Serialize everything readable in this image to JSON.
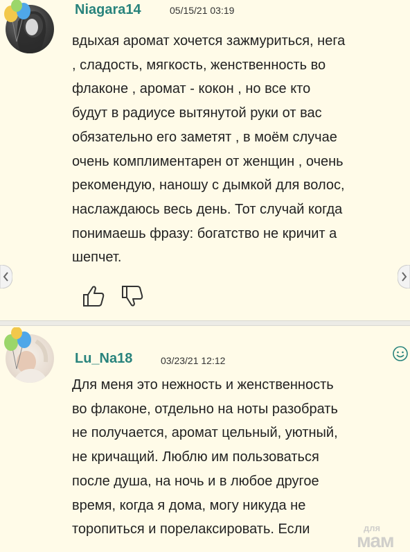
{
  "comments": [
    {
      "username": "Niagara14",
      "date": "05/15/21 03:19",
      "text": "вдыхая аромат хочется зажмуриться, нега\n, сладость, мягкость, женственность во\nфлаконе , аромат - кокон , но все кто\nбудут в радиусе вытянутой руки от вас\nобязательно его заметят , в моём случае\nочень комплиментарен от женщин , очень\nрекомендую, наношу с дымкой для волос,\nнаслаждаюсь весь день. Тот случай когда\nпонимаешь фразу: богатство не кричит а\nшепчет."
    },
    {
      "username": "Lu_Na18",
      "date": "03/23/21 12:12",
      "text": "Для меня это нежность и женственность\nво флаконе, отдельно на ноты разобрать\nне получается, аромат цельный, уютный,\nне кричащий. Люблю им пользоваться\nпосле душа, на ночь и в любое другое\nвремя, когда я дома, могу никуда не\nторопиться и порелаксировать. Если"
    }
  ],
  "watermark": {
    "line1": "для",
    "line2": "мам"
  },
  "colors": {
    "username": "#28837c",
    "background": "#fffbe8",
    "divider": "#ecebe6"
  },
  "icons": [
    "balloons-icon",
    "thumbs-up-icon",
    "thumbs-down-icon",
    "scroll-left-icon",
    "scroll-right-icon",
    "smiley-icon"
  ]
}
